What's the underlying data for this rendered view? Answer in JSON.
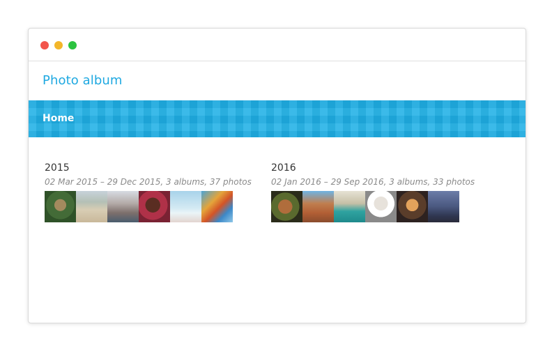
{
  "window": {
    "traffic_lights": [
      "close",
      "minimize",
      "zoom"
    ]
  },
  "header": {
    "site_title": "Photo album"
  },
  "nav": {
    "home": "Home"
  },
  "years": [
    {
      "title": "2015",
      "meta": "02 Mar 2015 – 29 Dec 2015, 3 albums, 37 photos"
    },
    {
      "title": "2016",
      "meta": "02 Jan 2016 – 29 Sep 2016, 3 albums, 33 photos"
    }
  ],
  "colors": {
    "accent": "#1fa9e1",
    "navbar": "#1fb0e6",
    "close": "#f2554c",
    "minimize": "#f3b62a",
    "zoom": "#2cc340"
  }
}
